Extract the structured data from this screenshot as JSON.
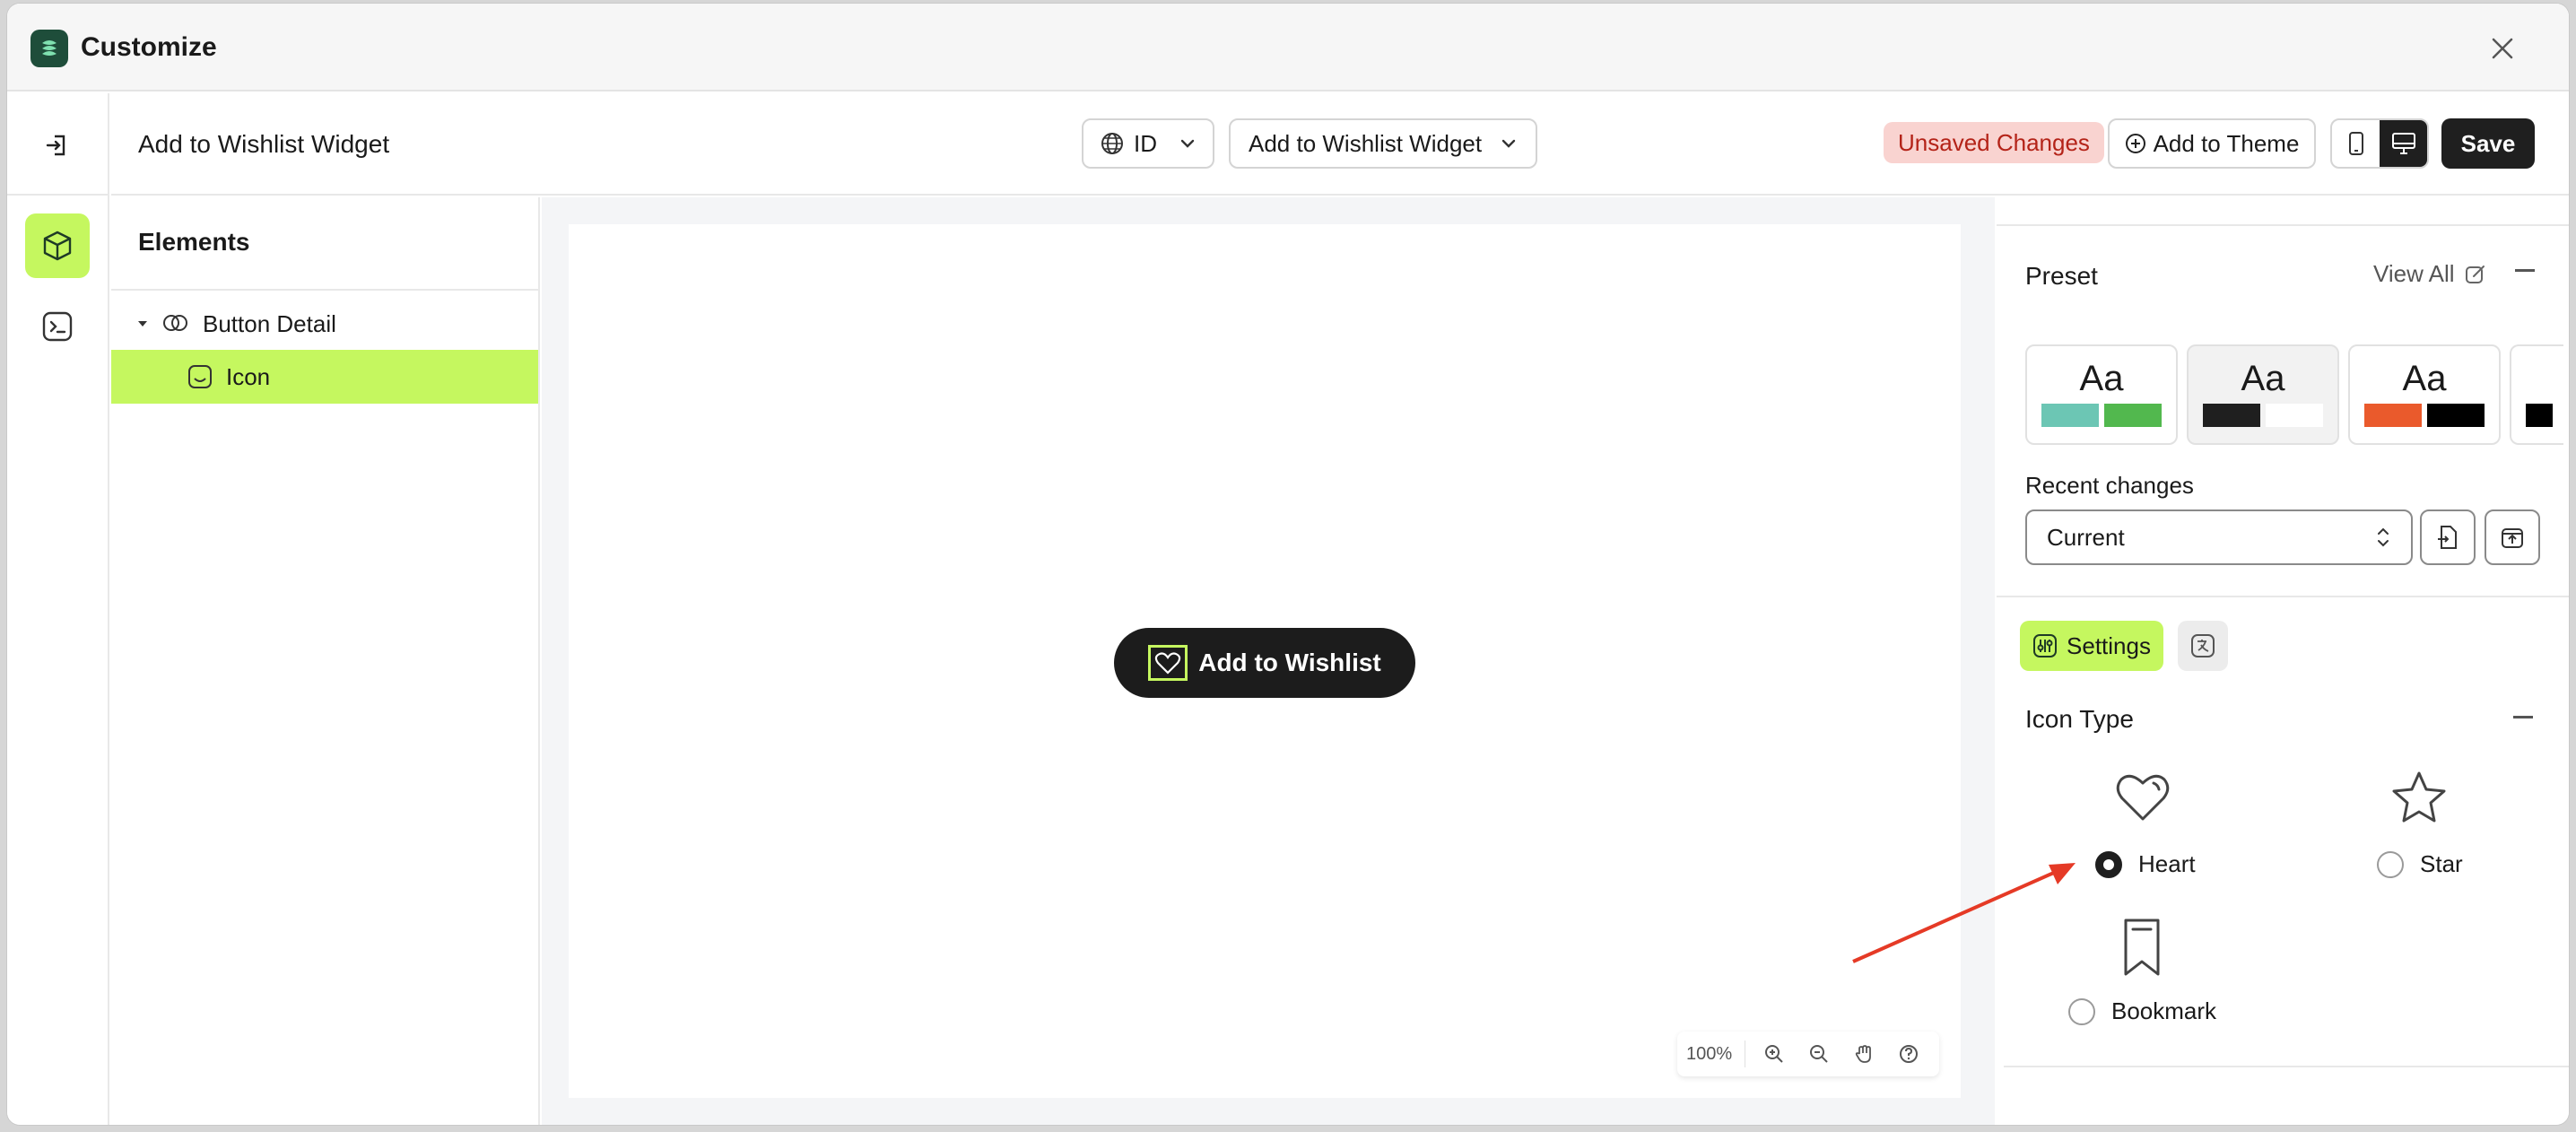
{
  "window": {
    "title": "Customize"
  },
  "header": {
    "title": "Add to Wishlist Widget",
    "language": "ID",
    "page": "Add to Wishlist Widget",
    "unsaved": "Unsaved Changes",
    "add_to_theme": "Add to Theme",
    "save": "Save"
  },
  "elements": {
    "title": "Elements",
    "tree": [
      {
        "label": "Button Detail",
        "icon": "component-icon"
      },
      {
        "label": "Icon",
        "icon": "icon-element-icon",
        "selected": true
      }
    ]
  },
  "canvas": {
    "button_label": "Add to Wishlist",
    "zoom": "100%"
  },
  "panel": {
    "preset_title": "Preset",
    "view_all": "View All",
    "presets": [
      {
        "label": "Aa",
        "colors": [
          "#6cc6b4",
          "#52b84e"
        ]
      },
      {
        "label": "Aa",
        "colors": [
          "#1f1f1f",
          "#ffffff"
        ],
        "selected": true
      },
      {
        "label": "Aa",
        "colors": [
          "#ea5a2c",
          "#000000"
        ]
      }
    ],
    "recent_label": "Recent changes",
    "recent_value": "Current",
    "settings_tab": "Settings",
    "icon_type_title": "Icon Type",
    "options": [
      {
        "label": "Heart",
        "icon": "heart-icon",
        "checked": true
      },
      {
        "label": "Star",
        "icon": "star-icon",
        "checked": false
      },
      {
        "label": "Bookmark",
        "icon": "bookmark-icon",
        "checked": false
      }
    ]
  },
  "colors": {
    "accent": "#c5f75f",
    "dark": "#1f1f1f",
    "unsaved_bg": "#f9d3d0",
    "unsaved_text": "#b42318",
    "annotation": "#e53a26"
  }
}
